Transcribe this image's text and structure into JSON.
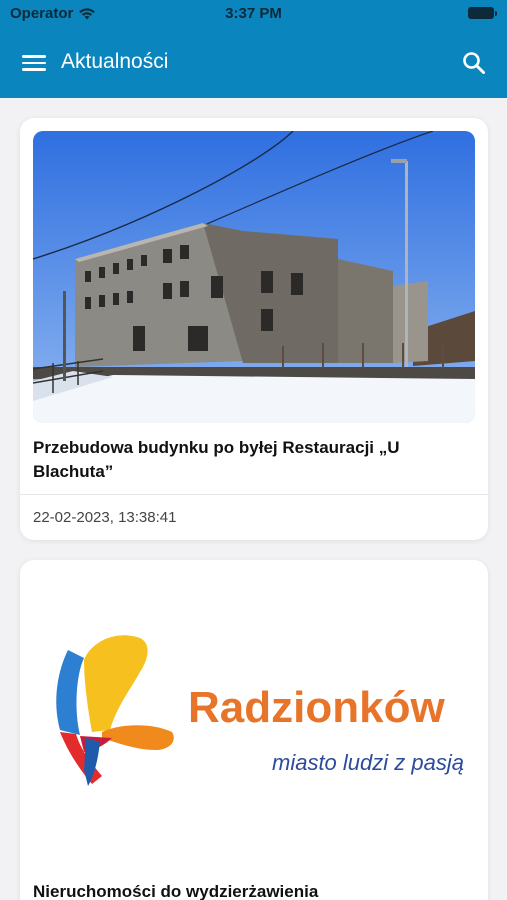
{
  "status_bar": {
    "carrier": "Operator",
    "time": "3:37 PM"
  },
  "header": {
    "title": "Aktualności"
  },
  "articles": [
    {
      "title": "Przebudowa budynku po byłej Restauracji „U Blachuta”",
      "date": "22-02-2023, 13:38:41",
      "image": "photo of old building with snow"
    },
    {
      "title": "Nieruchomości do wydzierżawienia",
      "image": "Radzionków logo",
      "logo": {
        "name": "Radzionków",
        "tagline": "miasto ludzi z pasją"
      }
    }
  ],
  "colors": {
    "header_bg": "#0a85bd",
    "logo_orange": "#e8742a",
    "logo_tagline_blue": "#2d4b9c"
  }
}
